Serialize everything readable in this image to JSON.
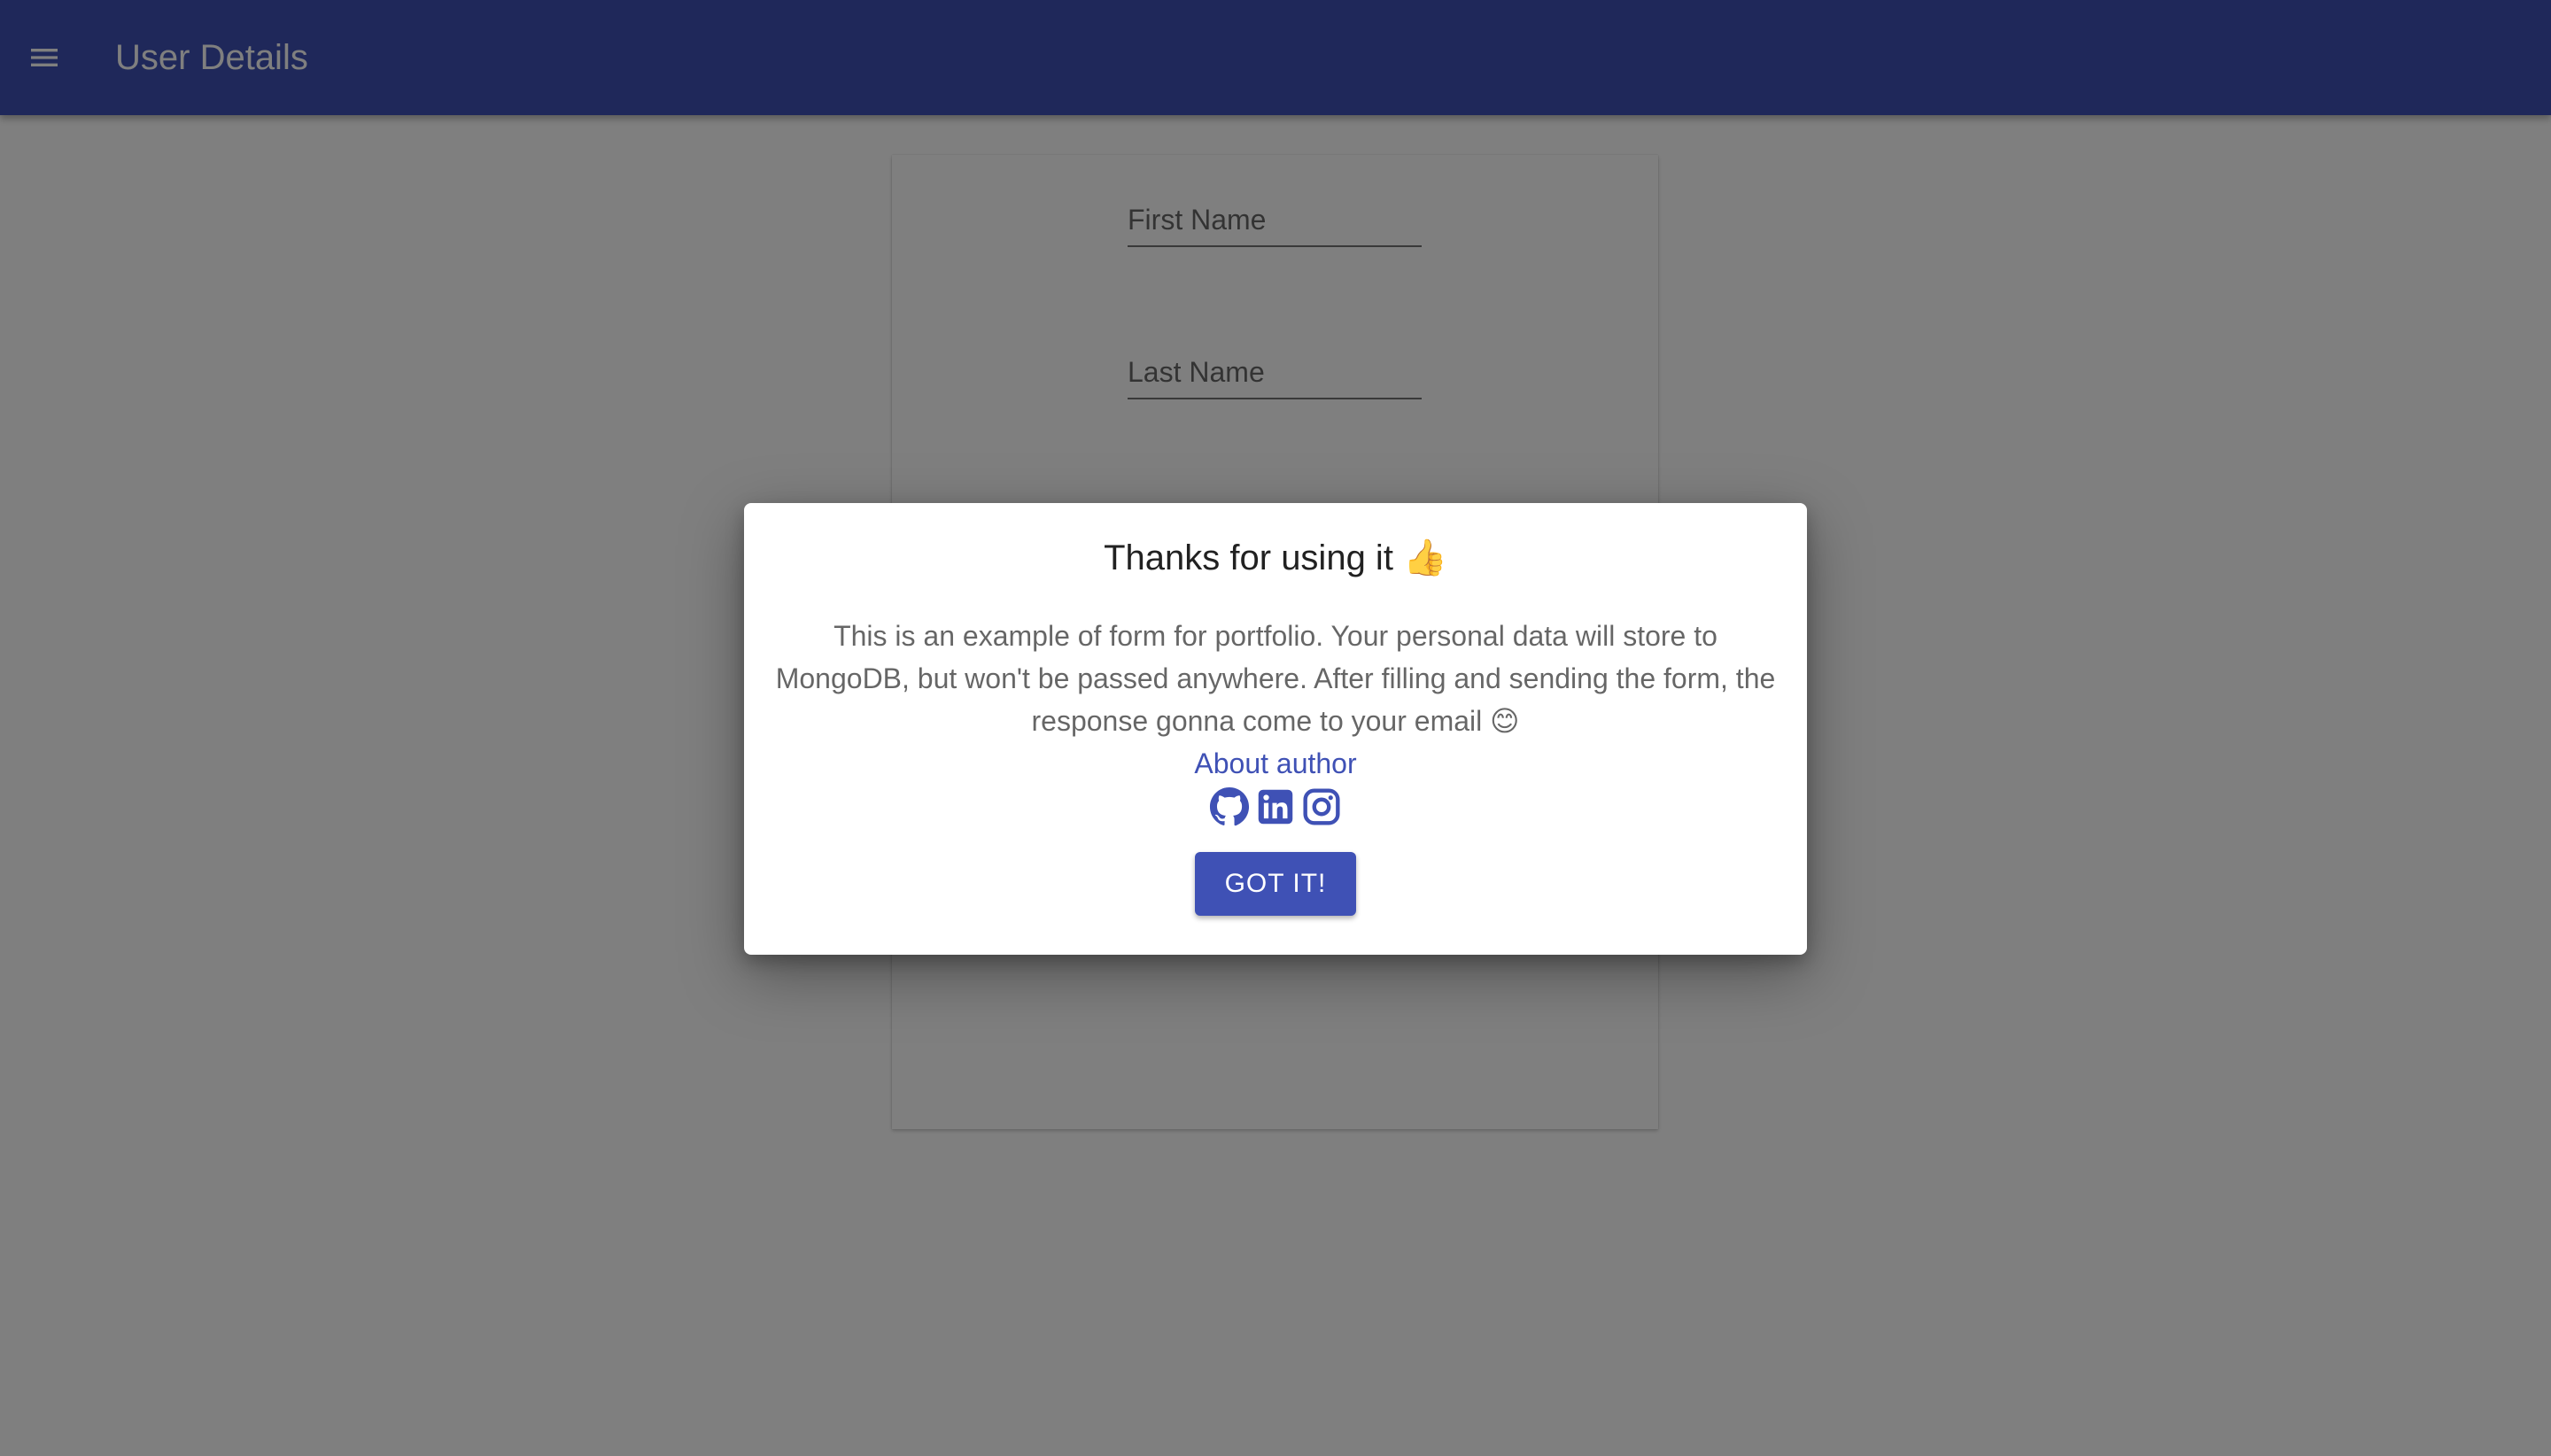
{
  "appbar": {
    "title": "User Details",
    "menu_icon": "menu-icon",
    "color": "#3f51b5"
  },
  "form": {
    "first_name": {
      "label": "First Name",
      "value": ""
    },
    "last_name": {
      "label": "Last Name",
      "value": ""
    }
  },
  "dialog": {
    "title": "Thanks for using it",
    "title_emoji": "👍",
    "body": "This is an example of form for portfolio. Your personal data will store to MongoDB, but won't be passed anywhere. After filling and sending the form, the response gonna come to your email",
    "body_emoji": "😊",
    "about_link": "About author",
    "socials": [
      "github-icon",
      "linkedin-icon",
      "instagram-icon"
    ],
    "confirm_label": "GOT IT!",
    "accent_color": "#3f51b5"
  }
}
